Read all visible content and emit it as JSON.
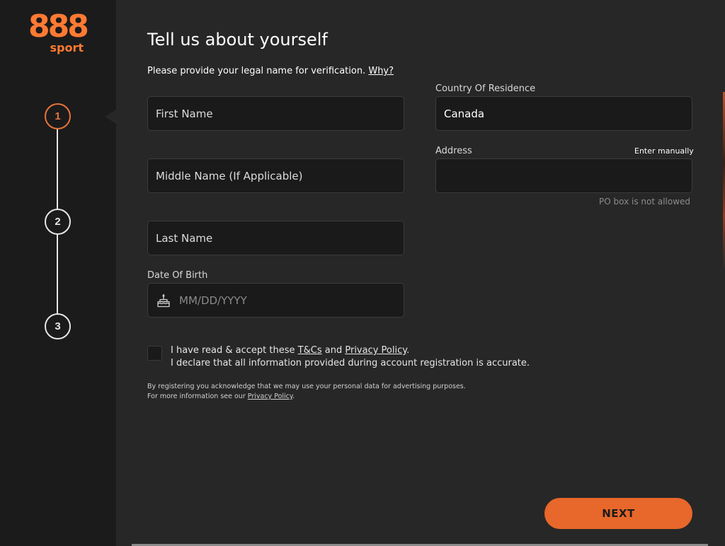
{
  "brand": {
    "logo_main": "888",
    "logo_sub": "sport"
  },
  "steps": [
    {
      "number": "1",
      "active": true
    },
    {
      "number": "2",
      "active": false
    },
    {
      "number": "3",
      "active": false
    }
  ],
  "form": {
    "title": "Tell us about yourself",
    "subtitle": "Please provide your legal name for verification.",
    "why_link": "Why?",
    "first_name_placeholder": "First Name",
    "middle_name_placeholder": "Middle Name (If Applicable)",
    "last_name_placeholder": "Last Name",
    "dob_label": "Date Of Birth",
    "dob_placeholder": "MM/DD/YYYY",
    "country_label": "Country Of Residence",
    "country_value": "Canada",
    "address_label": "Address",
    "address_manual_link": "Enter manually",
    "address_hint": "PO box is not allowed"
  },
  "consent": {
    "line1_prefix": "I have read & accept these",
    "tc_link": "T&Cs",
    "and": "and",
    "privacy_link": "Privacy Policy",
    "line1_suffix": ".",
    "line2": "I declare that all information provided during account registration is accurate."
  },
  "fine_print": {
    "line1": "By registering you acknowledge that we may use your personal data for advertising purposes.",
    "line2_prefix": "For more information see our",
    "privacy_link": "Privacy Policy",
    "line2_suffix": "."
  },
  "actions": {
    "next_label": "NEXT"
  },
  "colors": {
    "accent": "#e8672a",
    "sidebar_bg": "#1b1b1b",
    "page_bg": "#272727",
    "field_bg": "#1a1a1a"
  },
  "icons": {
    "dob": "birthday-cake-icon"
  }
}
